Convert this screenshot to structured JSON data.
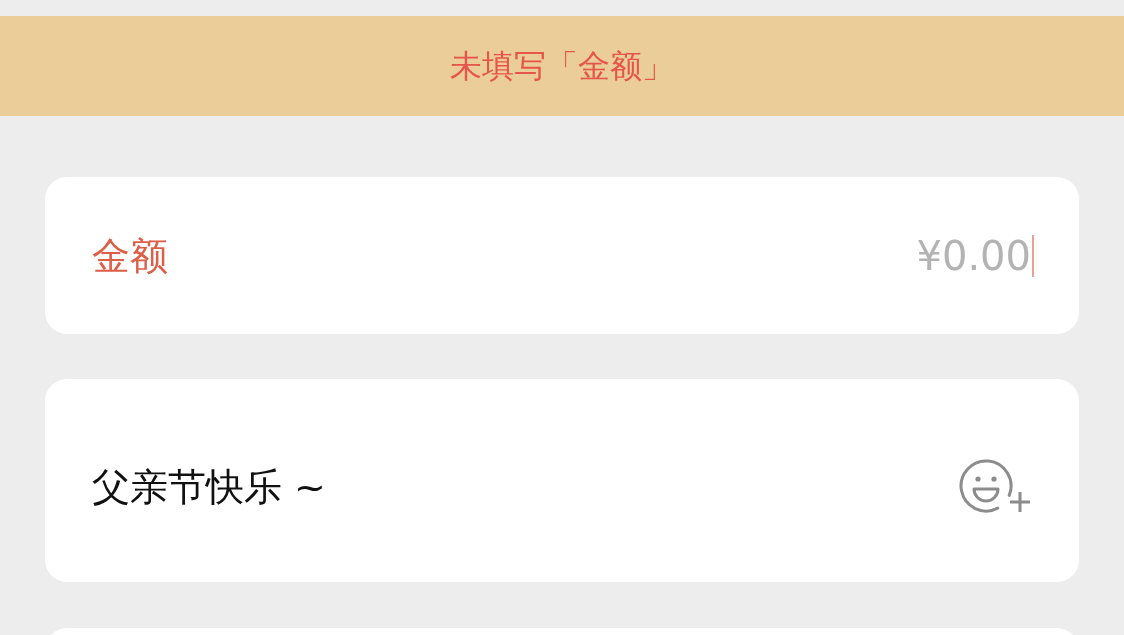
{
  "banner": {
    "text": "未填写「金额」"
  },
  "amount": {
    "label": "金额",
    "placeholder": "¥0.00",
    "invalid": true,
    "focused": true
  },
  "message": {
    "value": "父亲节快乐 ~"
  }
}
